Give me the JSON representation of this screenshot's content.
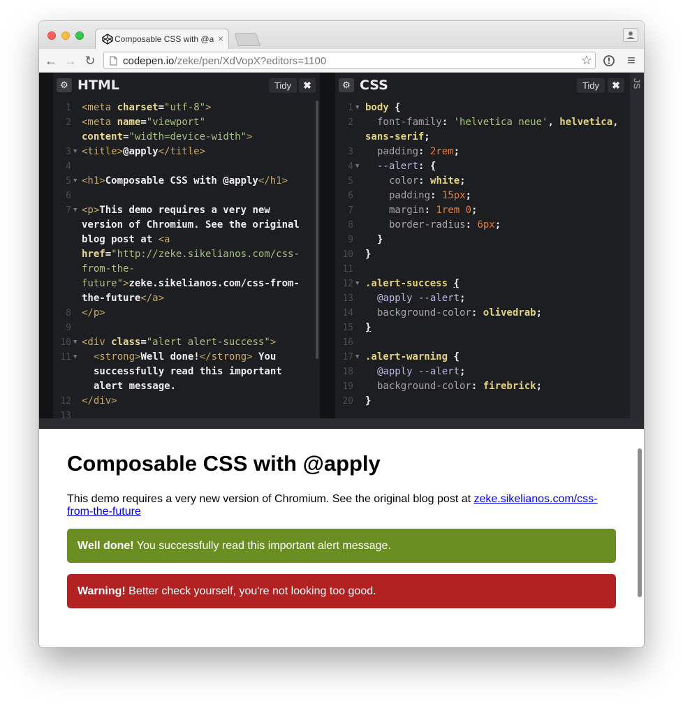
{
  "browser": {
    "tab_title": "Composable CSS with @apply",
    "url_host": "codepen.io",
    "url_rest": "/zeke/pen/XdVopX?editors=1100",
    "traffic_lights": {
      "close": "#fc605c",
      "minimize": "#fdbc40",
      "maximize": "#34c84a"
    }
  },
  "editor": {
    "html_title": "HTML",
    "css_title": "CSS",
    "js_title": "JS",
    "tidy_label": "Tidy",
    "close_label": "✖",
    "gear_icon": "⚙"
  },
  "preview": {
    "h1": "Composable CSS with @apply",
    "p_text": "This demo requires a very new version of Chromium. See the original blog post at ",
    "link_text": "zeke.sikelianos.com/css-from-the-future",
    "success_strong": "Well done!",
    "success_text": " You successfully read this important alert message.",
    "warning_strong": "Warning!",
    "warning_text": " Better check yourself, you're not looking too good.",
    "colors": {
      "success": "#6b8e23",
      "warning": "#b22222"
    }
  }
}
